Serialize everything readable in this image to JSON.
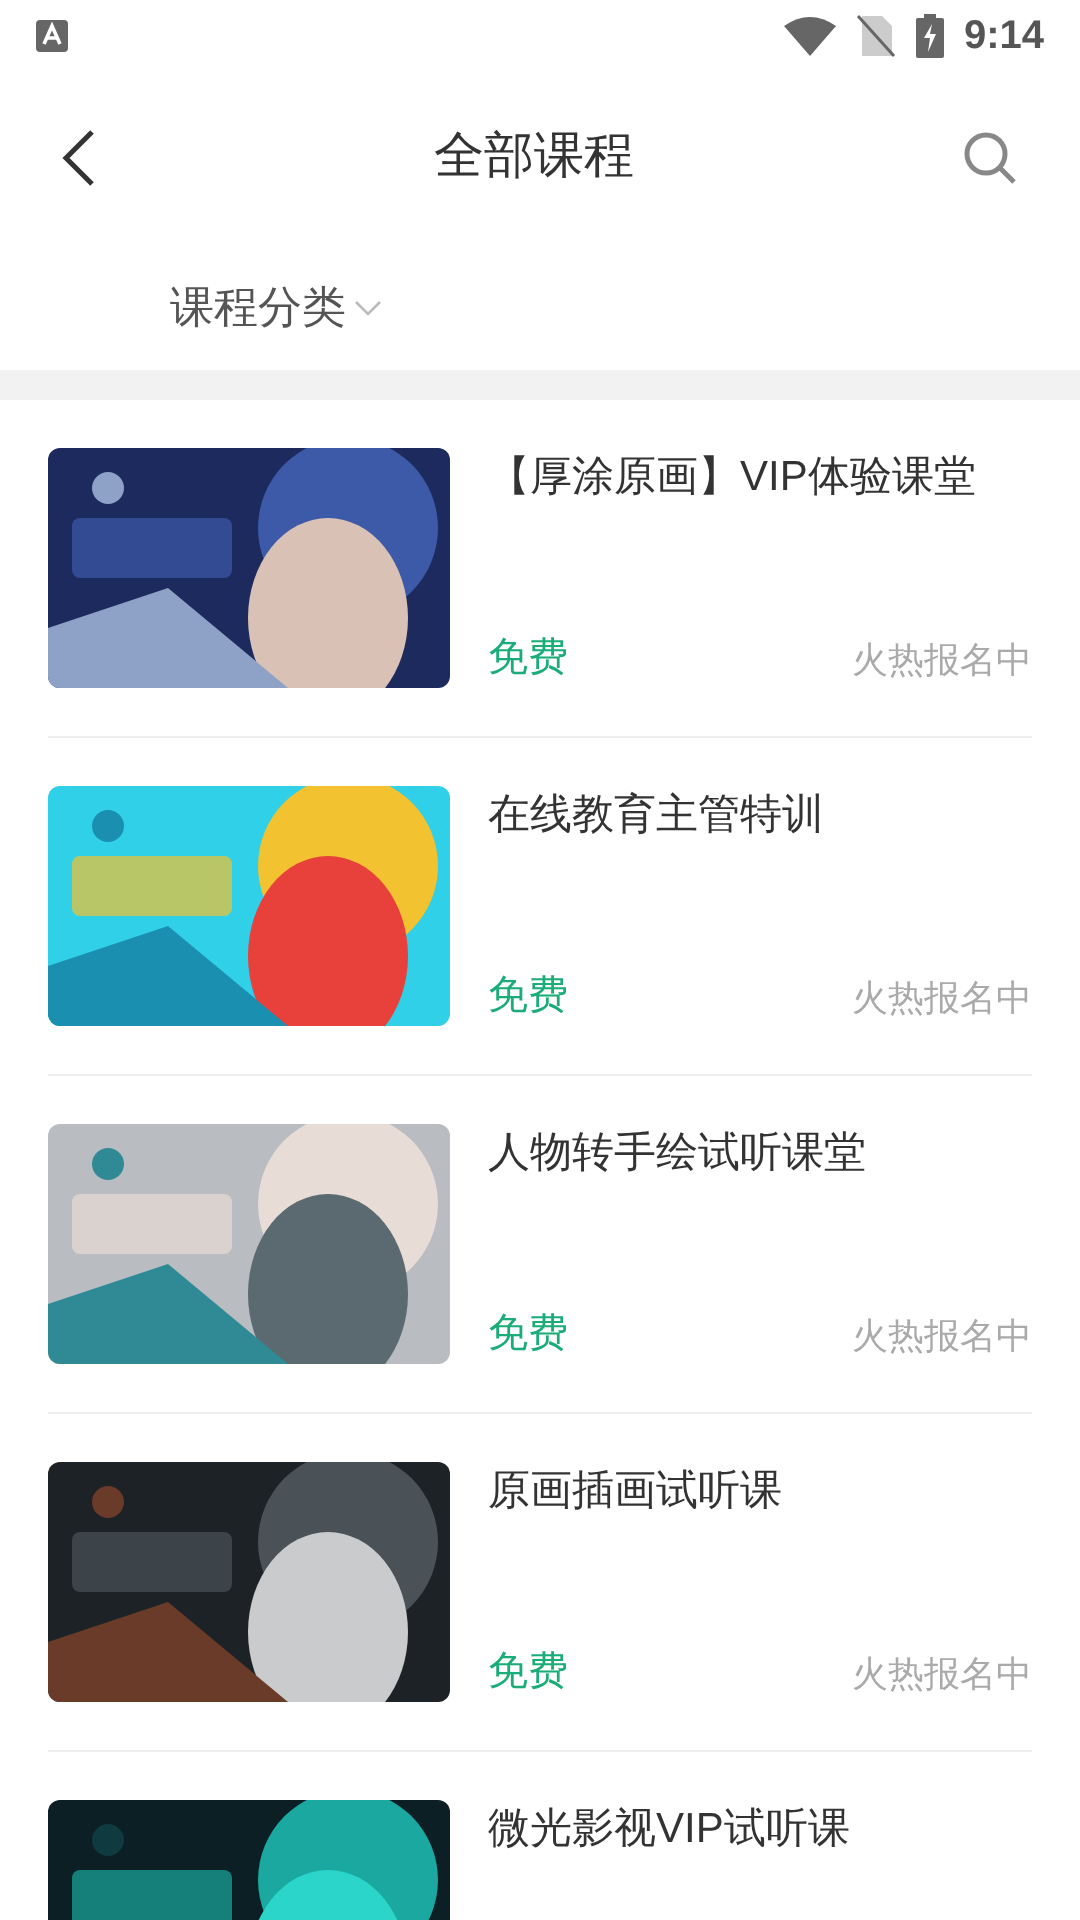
{
  "status_bar": {
    "time": "9:14"
  },
  "header": {
    "title": "全部课程"
  },
  "filter": {
    "label": "课程分类"
  },
  "courses": [
    {
      "title": "【厚涂原画】VIP体验课堂",
      "price": "免费",
      "status": "火热报名中"
    },
    {
      "title": "在线教育主管特训",
      "price": "免费",
      "status": "火热报名中"
    },
    {
      "title": "人物转手绘试听课堂",
      "price": "免费",
      "status": "火热报名中"
    },
    {
      "title": "原画插画试听课",
      "price": "免费",
      "status": "火热报名中"
    },
    {
      "title": "微光影视VIP试听课"
    }
  ]
}
